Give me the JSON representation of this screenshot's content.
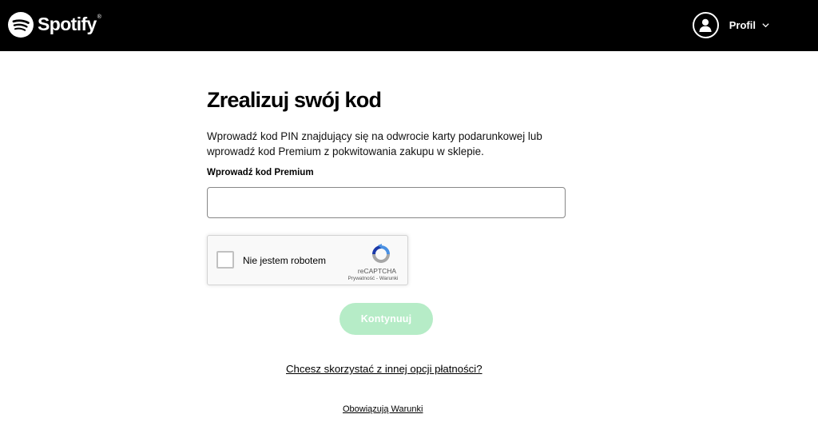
{
  "header": {
    "brand": "Spotify",
    "brand_mark": "®",
    "logo_icon": "spotify-logo-icon",
    "profile_label": "Profil",
    "avatar_icon": "user-icon",
    "dropdown_icon": "chevron-down-icon"
  },
  "main": {
    "title": "Zrealizuj swój kod",
    "description": "Wprowadź kod PIN znajdujący się na odwrocie karty podarunkowej lub wprowadź kod Premium z pokwitowania zakupu w sklepie.",
    "field_label": "Wprowadź kod Premium",
    "field_value": "",
    "continue_label": "Kontynuuj",
    "other_payment_link": "Chcesz skorzystać z innej opcji płatności?",
    "terms_link": "Obowiązują Warunki"
  },
  "captcha": {
    "label": "Nie jestem robotem",
    "brand": "reCAPTCHA",
    "privacy_link": "Prywatność",
    "separator": "-",
    "terms_link": "Warunki",
    "checked": false
  },
  "colors": {
    "header_bg": "#000000",
    "continue_button_disabled": "#b6ecc7",
    "page_bg": "#ffffff"
  }
}
